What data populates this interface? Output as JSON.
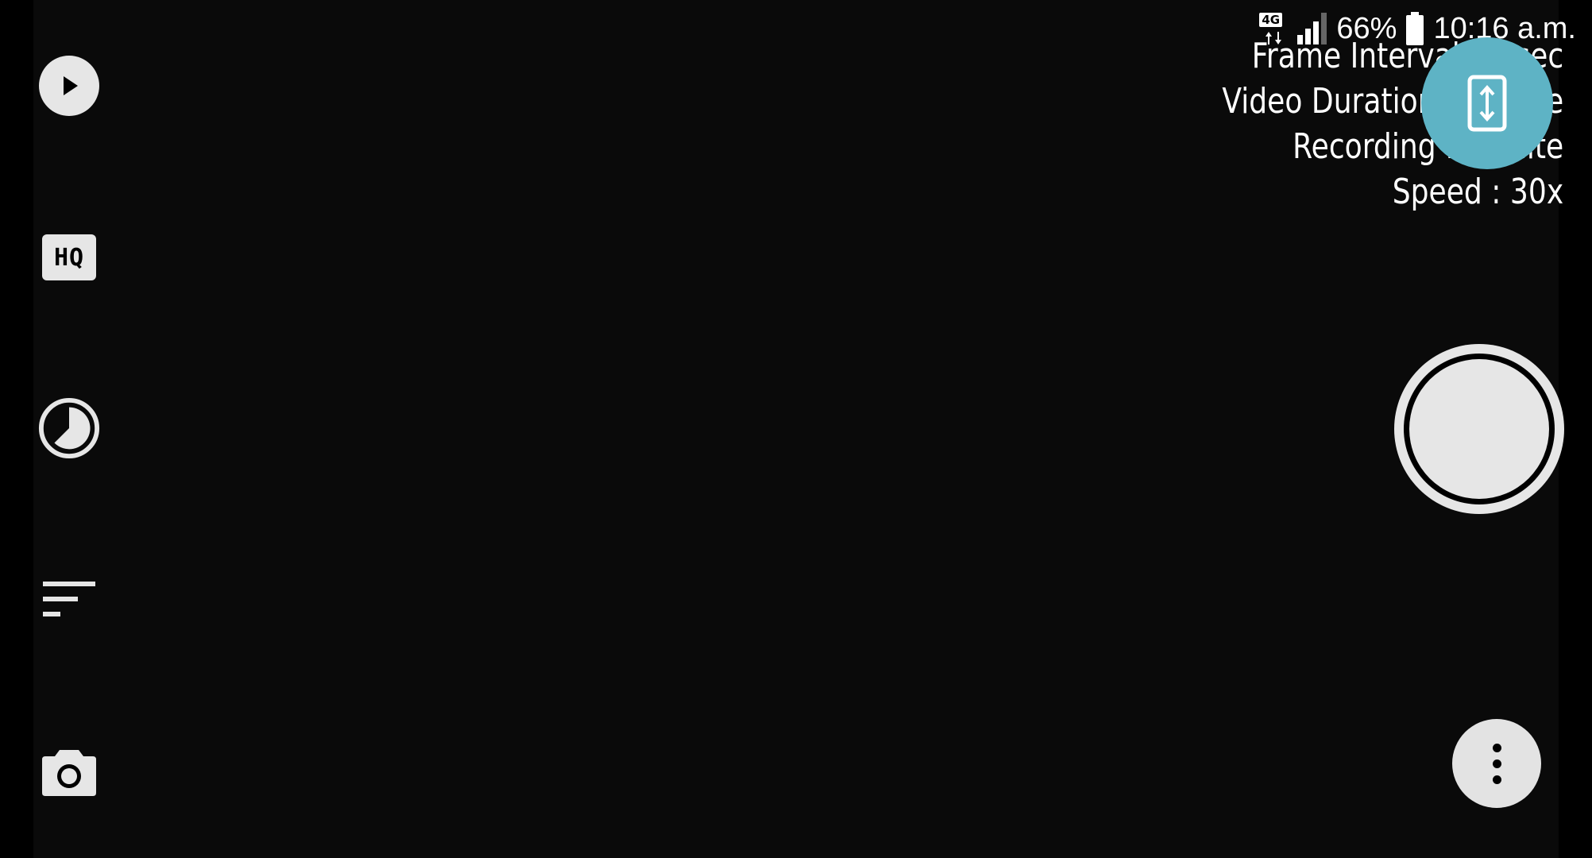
{
  "status_bar": {
    "network_type": "4G",
    "battery_percent": "66%",
    "time": "10:16 a.m.",
    "signal_bars_filled": 3,
    "signal_bars_total": 4
  },
  "overlay": {
    "frame_interval": "Frame Interval : 1 sec",
    "video_duration": "Video Duration : Infinite",
    "recording_limit": "Recording : Infinite",
    "speed": "Speed : 30x"
  },
  "left_toolbar": {
    "items": [
      {
        "name": "play-button",
        "icon": "play-icon"
      },
      {
        "name": "quality-button",
        "icon": "hq-icon",
        "label": "HQ"
      },
      {
        "name": "timer-button",
        "icon": "timer-icon"
      },
      {
        "name": "filter-button",
        "icon": "sort-icon"
      },
      {
        "name": "camera-button",
        "icon": "camera-icon"
      }
    ]
  },
  "right_controls": {
    "rotate": {
      "icon": "swap-vertical-icon"
    },
    "shutter": {
      "icon": "shutter-icon"
    },
    "more": {
      "icon": "more-vert-icon"
    }
  },
  "colors": {
    "background": "#000000",
    "preview": "#0a0a0a",
    "fab": "#5eb3c5",
    "control": "#e6e6e6"
  }
}
